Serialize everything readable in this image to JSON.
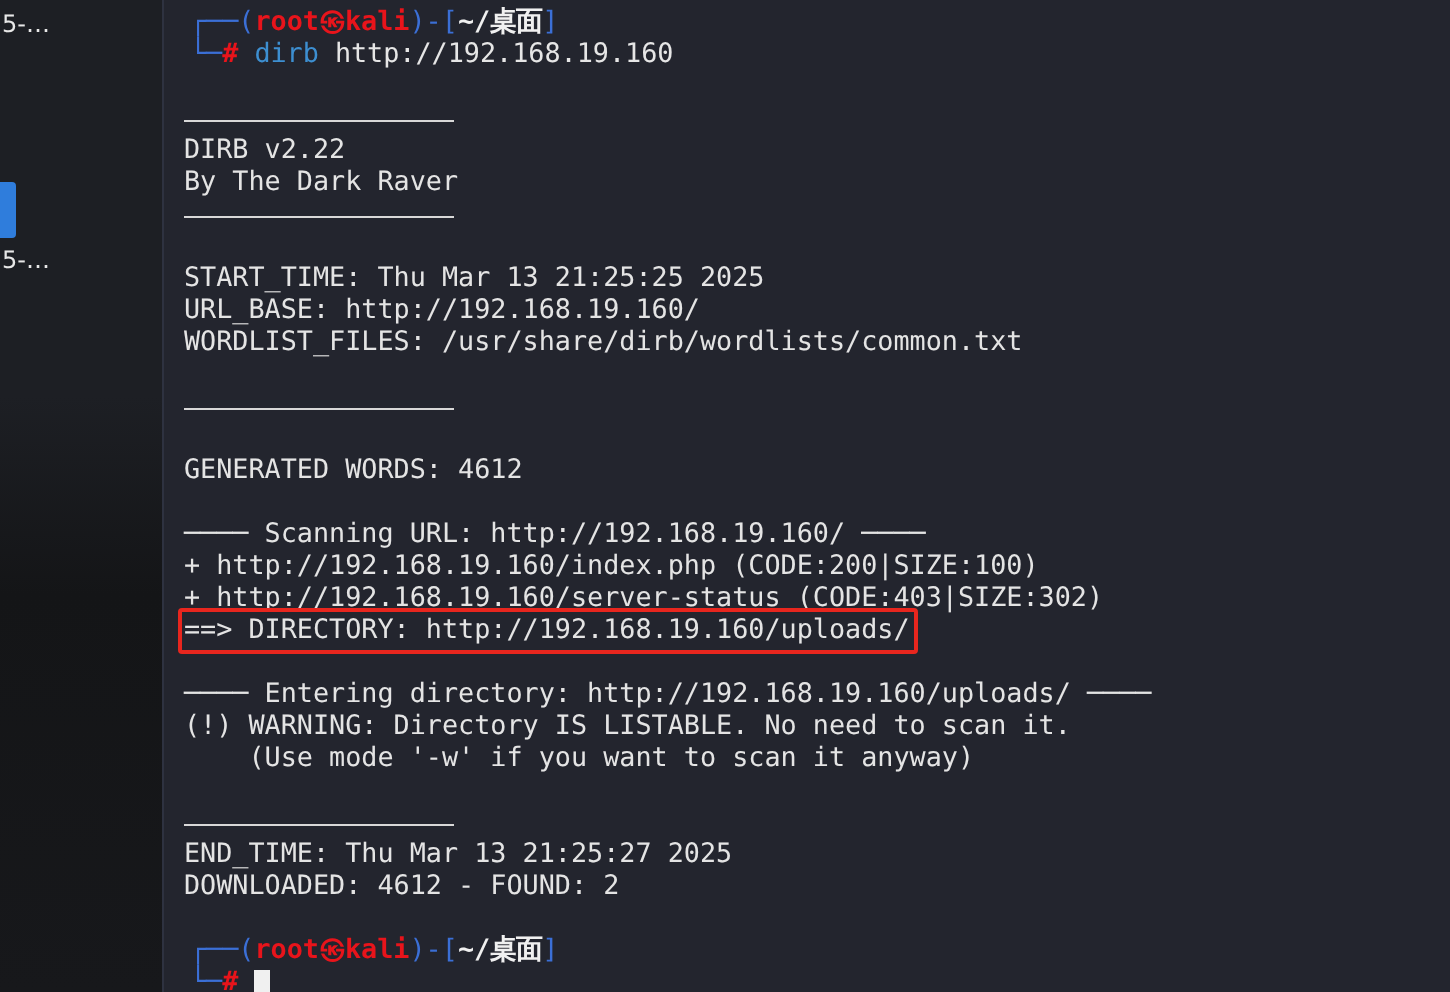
{
  "desktop": {
    "labels": [
      "5-…",
      "5-…"
    ]
  },
  "terminal": {
    "lines": [
      {
        "kind": "prompt_top",
        "open": "┌──(",
        "user": "root㉿kali",
        "sep": ")-[",
        "path": "~/桌面",
        "close": "]"
      },
      {
        "kind": "prompt_bottom",
        "cursor": false,
        "corner": "└─",
        "mark": "#",
        "command": "dirb",
        "args": "http://192.168.19.160"
      },
      {
        "kind": "blank"
      },
      {
        "kind": "rule"
      },
      {
        "kind": "text",
        "boxed": false,
        "text": "DIRB v2.22"
      },
      {
        "kind": "text",
        "boxed": false,
        "text": "By The Dark Raver"
      },
      {
        "kind": "rule"
      },
      {
        "kind": "blank"
      },
      {
        "kind": "text",
        "boxed": false,
        "text": "START_TIME: Thu Mar 13 21:25:25 2025"
      },
      {
        "kind": "text",
        "boxed": false,
        "text": "URL_BASE: http://192.168.19.160/"
      },
      {
        "kind": "text",
        "boxed": false,
        "text": "WORDLIST_FILES: /usr/share/dirb/wordlists/common.txt"
      },
      {
        "kind": "blank"
      },
      {
        "kind": "rule"
      },
      {
        "kind": "blank"
      },
      {
        "kind": "text",
        "boxed": false,
        "text": "GENERATED WORDS: 4612"
      },
      {
        "kind": "blank"
      },
      {
        "kind": "text",
        "boxed": false,
        "text": "──── Scanning URL: http://192.168.19.160/ ────"
      },
      {
        "kind": "text",
        "boxed": false,
        "text": "+ http://192.168.19.160/index.php (CODE:200|SIZE:100)"
      },
      {
        "kind": "text",
        "boxed": false,
        "text": "+ http://192.168.19.160/server-status (CODE:403|SIZE:302)"
      },
      {
        "kind": "text",
        "boxed": true,
        "text": "==> DIRECTORY: http://192.168.19.160/uploads/"
      },
      {
        "kind": "blank"
      },
      {
        "kind": "text",
        "boxed": false,
        "text": "──── Entering directory: http://192.168.19.160/uploads/ ────"
      },
      {
        "kind": "text",
        "boxed": false,
        "text": "(!) WARNING: Directory IS LISTABLE. No need to scan it."
      },
      {
        "kind": "text",
        "boxed": false,
        "text": "    (Use mode '-w' if you want to scan it anyway)"
      },
      {
        "kind": "blank"
      },
      {
        "kind": "rule"
      },
      {
        "kind": "text",
        "boxed": false,
        "text": "END_TIME: Thu Mar 13 21:25:27 2025"
      },
      {
        "kind": "text",
        "boxed": false,
        "text": "DOWNLOADED: 4612 - FOUND: 2"
      },
      {
        "kind": "blank"
      },
      {
        "kind": "prompt_top",
        "open": "┌──(",
        "user": "root㉿kali",
        "sep": ")-[",
        "path": "~/桌面",
        "close": "]"
      },
      {
        "kind": "prompt_bottom",
        "cursor": true,
        "corner": "└─",
        "mark": "#"
      }
    ]
  }
}
